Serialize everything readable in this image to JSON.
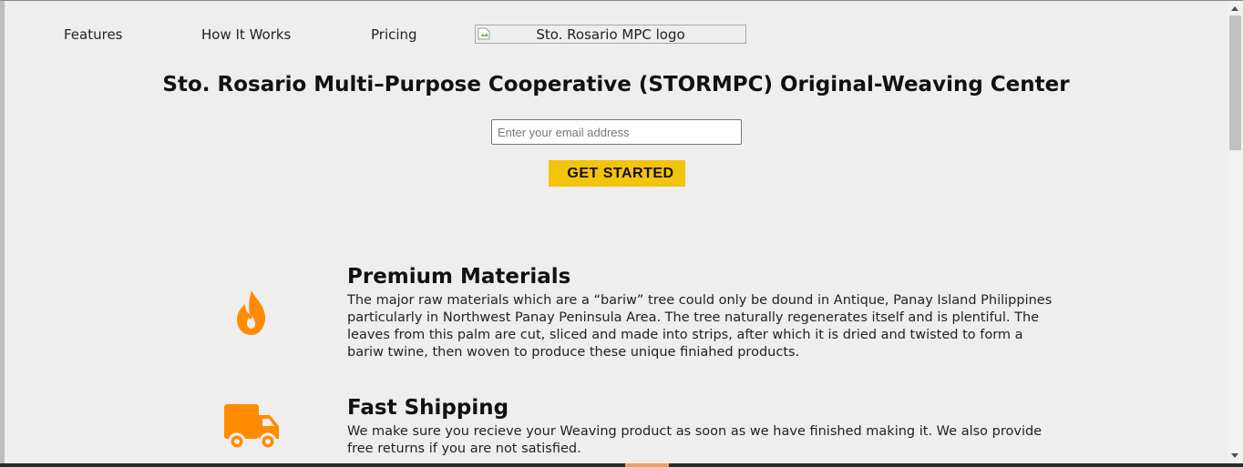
{
  "nav": {
    "items": [
      {
        "label": "Features"
      },
      {
        "label": "How It Works"
      },
      {
        "label": "Pricing"
      }
    ],
    "logo_alt": "Sto. Rosario MPC logo"
  },
  "hero": {
    "title": "Sto. Rosario Multi–Purpose Cooperative (STORMPC) Original-Weaving Center",
    "email_placeholder": "Enter your email address",
    "cta_label": "GET STARTED"
  },
  "features": [
    {
      "icon": "fire-icon",
      "title": "Premium Materials",
      "description": "The major raw materials which are a “bariw” tree could only be dound in Antique, Panay Island Philippines particularly in Northwest Panay Peninsula Area. The tree naturally regenerates itself and is plentiful. The leaves from this palm are cut, sliced and made into strips, after which it is dried and twisted to form a bariw twine, then woven to produce these unique finiahed products."
    },
    {
      "icon": "truck-icon",
      "title": "Fast Shipping",
      "description": "We make sure you recieve your Weaving product as soon as we have finished making it. We also provide free returns if you are not satisfied."
    }
  ],
  "colors": {
    "accent": "#f2c40c",
    "icon": "#ff8c00",
    "page_background": "#eeeeee"
  }
}
